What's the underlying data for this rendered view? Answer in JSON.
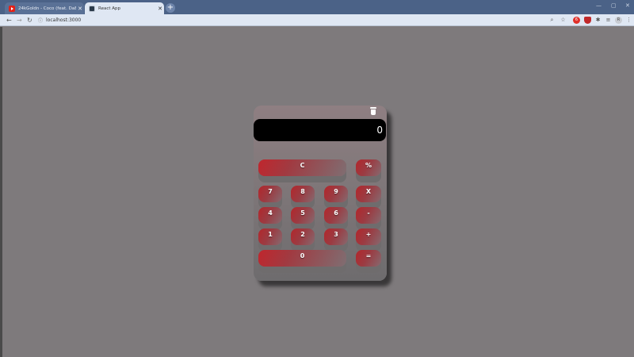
{
  "browser": {
    "tabs": [
      {
        "title": "24kGoldn - Coco (feat. DaB...",
        "favicon": "youtube-icon",
        "active": false
      },
      {
        "title": "React App",
        "favicon": "react-icon",
        "active": true
      }
    ],
    "new_tab": "+",
    "close_glyph": "✕",
    "url": "localhost:3000",
    "window_controls": {
      "minimize": "—",
      "maximize": "▢",
      "close": "✕"
    },
    "avatar_letter": "R",
    "extension_badge": "6"
  },
  "calculator": {
    "display_value": "0",
    "keys": {
      "clear": "C",
      "percent": "%",
      "seven": "7",
      "eight": "8",
      "nine": "9",
      "multiply": "X",
      "four": "4",
      "five": "5",
      "six": "6",
      "minus": "-",
      "one": "1",
      "two": "2",
      "three": "3",
      "plus": "+",
      "zero": "0",
      "equals": "="
    },
    "colors": {
      "accent": "#b3262b",
      "body": "#7f7779",
      "display": "#000000"
    }
  }
}
